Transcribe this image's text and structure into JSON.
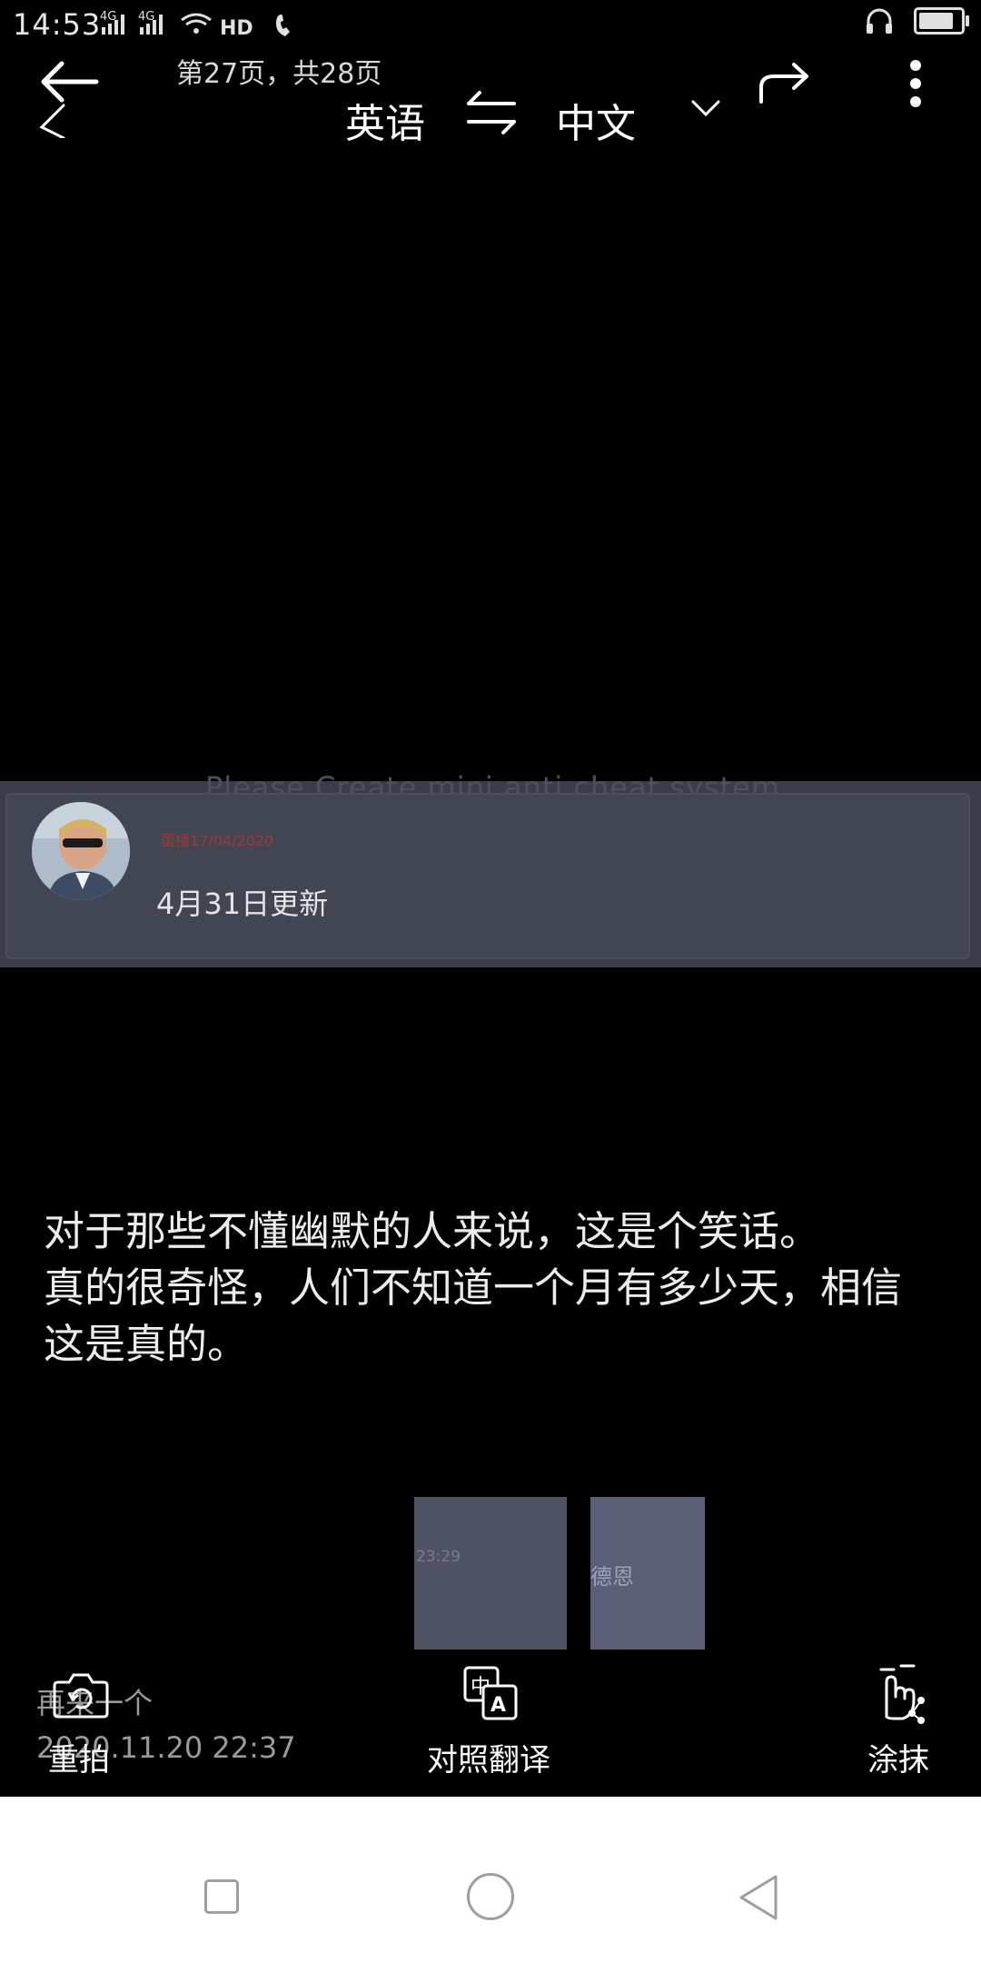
{
  "status_bar": {
    "time": "14:53",
    "network_icons": "4G 4G HD2",
    "battery_level": 0.85
  },
  "top_bar": {
    "page_indicator": "第27页，共28页",
    "source_language": "英语",
    "target_language": "中文"
  },
  "card": {
    "faded_text": "Please Create mini anti cheat system",
    "meta": "蛋播17/04/2020",
    "update_text": "4月31日更新"
  },
  "translation": {
    "paragraphs": [
      "对于那些不懂幽默的人来说，这是个笑话。",
      "真的很奇怪，人们不知道一个月有多少天，相信这是真的。"
    ]
  },
  "thumbnails": [
    {
      "text": "23:29"
    },
    {
      "text": "德恩"
    }
  ],
  "ghost": {
    "label": "再来一个",
    "date": "2020.11.20 22:37"
  },
  "toolbar": {
    "retake_label": "重拍",
    "compare_label": "对照翻译",
    "smear_label": "涂抹"
  },
  "colors": {
    "background": "#000000",
    "card": "#424552",
    "navbar": "#ffffff"
  }
}
